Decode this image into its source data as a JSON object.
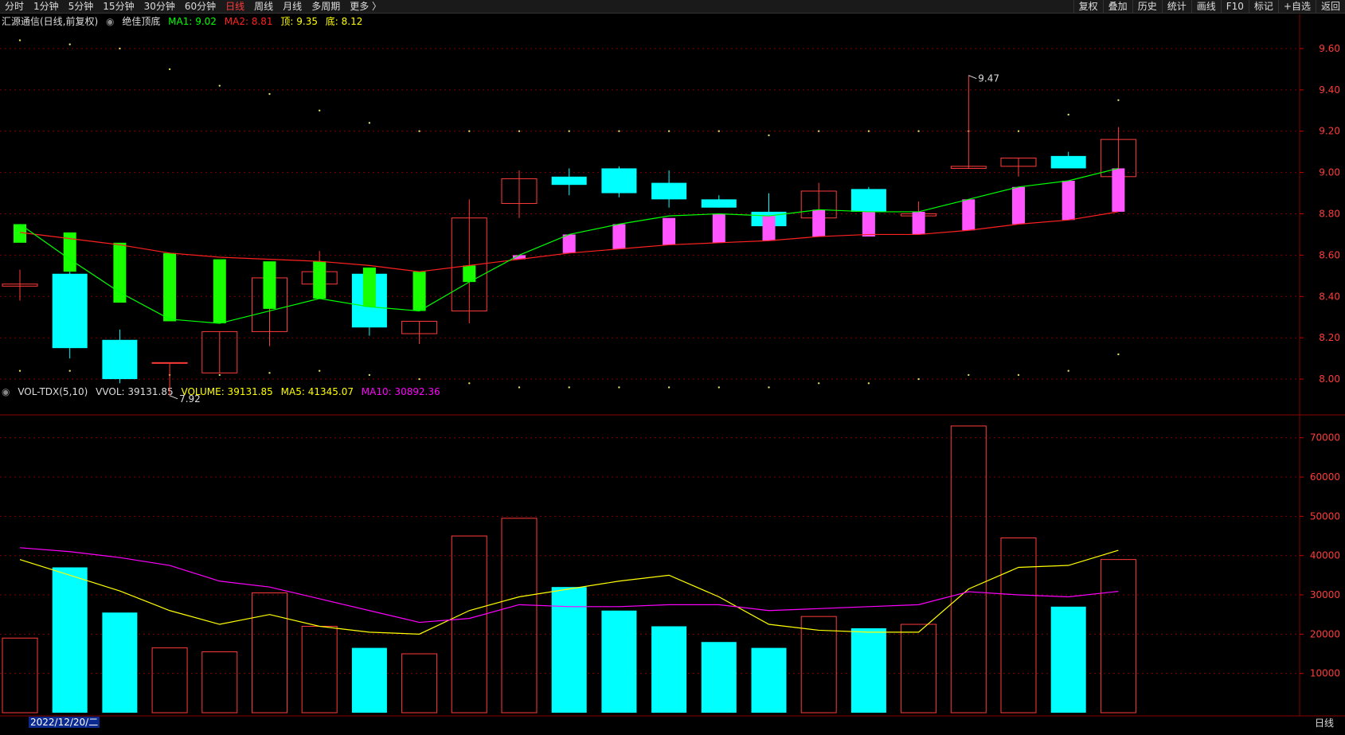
{
  "toolbar": {
    "left_tabs": [
      "分时",
      "1分钟",
      "5分钟",
      "15分钟",
      "30分钟",
      "60分钟",
      "日线",
      "周线",
      "月线",
      "多周期",
      "更多 〉"
    ],
    "active_tab": "日线",
    "right_tabs": [
      "复权",
      "叠加",
      "历史",
      "统计",
      "画线",
      "F10",
      "标记",
      "+自选",
      "返回"
    ]
  },
  "main_legend": {
    "title": "汇源通信(日线,前复权)",
    "indicator": "绝佳顶底",
    "ma1": "MA1: 9.02",
    "ma2": "MA2: 8.81",
    "top": "顶: 9.35",
    "bottom": "底: 8.12"
  },
  "vol_legend": {
    "name": "VOL-TDX(5,10)",
    "vvol": "VVOL: 39131.85",
    "volume": "VOLUME: 39131.85",
    "ma5": "MA5: 41345.07",
    "ma10": "MA10: 30892.36"
  },
  "colors": {
    "up": "#ff3b3b",
    "down_fill": "#00ffff",
    "indicator_green": "#18ff00",
    "indicator_pink": "#ff55ff",
    "ma1": "#00ff00",
    "ma2": "#ff2020",
    "vol_ma5": "#ffff00",
    "vol_ma10": "#ff00ff",
    "grid": "#7a0000"
  },
  "annotations": {
    "high": "9.47",
    "low": "7.92"
  },
  "status": {
    "date": "2022/12/20/二",
    "period_button": "日线"
  },
  "chart_data": [
    {
      "type": "candlestick",
      "title": "汇源通信(日线,前复权)",
      "ylim": [
        7.85,
        9.7
      ],
      "y_ticks": [
        "9.60",
        "9.40",
        "9.20",
        "9.00",
        "8.80",
        "8.60",
        "8.40",
        "8.20",
        "8.00"
      ],
      "candles": [
        {
          "o": 8.45,
          "h": 8.53,
          "l": 8.38,
          "c": 8.46,
          "up": true
        },
        {
          "o": 8.51,
          "h": 8.52,
          "l": 8.1,
          "c": 8.15,
          "up": false
        },
        {
          "o": 8.19,
          "h": 8.24,
          "l": 7.98,
          "c": 8.0,
          "up": false
        },
        {
          "o": 8.08,
          "h": 8.08,
          "l": 7.92,
          "c": 8.08,
          "up": true
        },
        {
          "o": 8.03,
          "h": 8.23,
          "l": 8.03,
          "c": 8.23,
          "up": true
        },
        {
          "o": 8.23,
          "h": 8.49,
          "l": 8.16,
          "c": 8.49,
          "up": true
        },
        {
          "o": 8.46,
          "h": 8.62,
          "l": 8.46,
          "c": 8.52,
          "up": true
        },
        {
          "o": 8.51,
          "h": 8.51,
          "l": 8.21,
          "c": 8.25,
          "up": false
        },
        {
          "o": 8.22,
          "h": 8.28,
          "l": 8.17,
          "c": 8.28,
          "up": true
        },
        {
          "o": 8.33,
          "h": 8.87,
          "l": 8.27,
          "c": 8.78,
          "up": true
        },
        {
          "o": 8.85,
          "h": 9.01,
          "l": 8.78,
          "c": 8.97,
          "up": true
        },
        {
          "o": 8.98,
          "h": 9.02,
          "l": 8.89,
          "c": 8.94,
          "up": false
        },
        {
          "o": 9.02,
          "h": 9.03,
          "l": 8.88,
          "c": 8.9,
          "up": false
        },
        {
          "o": 8.95,
          "h": 9.01,
          "l": 8.83,
          "c": 8.87,
          "up": false
        },
        {
          "o": 8.87,
          "h": 8.89,
          "l": 8.83,
          "c": 8.83,
          "up": false
        },
        {
          "o": 8.81,
          "h": 8.9,
          "l": 8.74,
          "c": 8.74,
          "up": false
        },
        {
          "o": 8.78,
          "h": 8.95,
          "l": 8.78,
          "c": 8.91,
          "up": true
        },
        {
          "o": 8.92,
          "h": 8.93,
          "l": 8.8,
          "c": 8.81,
          "up": false
        },
        {
          "o": 8.79,
          "h": 8.86,
          "l": 8.79,
          "c": 8.8,
          "up": true
        },
        {
          "o": 9.02,
          "h": 9.47,
          "l": 9.02,
          "c": 9.03,
          "up": true
        },
        {
          "o": 9.03,
          "h": 9.07,
          "l": 8.98,
          "c": 9.07,
          "up": true
        },
        {
          "o": 9.08,
          "h": 9.1,
          "l": 9.02,
          "c": 9.02,
          "up": false
        },
        {
          "o": 8.98,
          "h": 9.22,
          "l": 8.98,
          "c": 9.16,
          "up": true
        }
      ],
      "indicator_bars": [
        {
          "y1": 8.75,
          "y2": 8.66,
          "c": "green"
        },
        {
          "y1": 8.71,
          "y2": 8.52,
          "c": "green"
        },
        {
          "y1": 8.66,
          "y2": 8.37,
          "c": "green"
        },
        {
          "y1": 8.61,
          "y2": 8.28,
          "c": "green"
        },
        {
          "y1": 8.58,
          "y2": 8.27,
          "c": "green"
        },
        {
          "y1": 8.57,
          "y2": 8.34,
          "c": "green"
        },
        {
          "y1": 8.57,
          "y2": 8.39,
          "c": "green"
        },
        {
          "y1": 8.54,
          "y2": 8.35,
          "c": "green"
        },
        {
          "y1": 8.52,
          "y2": 8.33,
          "c": "green"
        },
        {
          "y1": 8.55,
          "y2": 8.47,
          "c": "green"
        },
        {
          "y1": 8.6,
          "y2": 8.58,
          "c": "pink"
        },
        {
          "y1": 8.7,
          "y2": 8.61,
          "c": "pink"
        },
        {
          "y1": 8.75,
          "y2": 8.63,
          "c": "pink"
        },
        {
          "y1": 8.78,
          "y2": 8.65,
          "c": "pink"
        },
        {
          "y1": 8.8,
          "y2": 8.66,
          "c": "pink"
        },
        {
          "y1": 8.79,
          "y2": 8.67,
          "c": "pink"
        },
        {
          "y1": 8.82,
          "y2": 8.69,
          "c": "pink"
        },
        {
          "y1": 8.81,
          "y2": 8.69,
          "c": "pink"
        },
        {
          "y1": 8.81,
          "y2": 8.7,
          "c": "pink"
        },
        {
          "y1": 8.87,
          "y2": 8.72,
          "c": "pink"
        },
        {
          "y1": 8.93,
          "y2": 8.75,
          "c": "pink"
        },
        {
          "y1": 8.96,
          "y2": 8.77,
          "c": "pink"
        },
        {
          "y1": 9.02,
          "y2": 8.81,
          "c": "pink"
        }
      ],
      "ma1": [
        8.75,
        8.58,
        8.42,
        8.29,
        8.27,
        8.33,
        8.39,
        8.35,
        8.33,
        8.47,
        8.6,
        8.7,
        8.75,
        8.79,
        8.8,
        8.79,
        8.82,
        8.81,
        8.81,
        8.87,
        8.93,
        8.96,
        9.02
      ],
      "ma2": [
        8.71,
        8.68,
        8.65,
        8.61,
        8.59,
        8.58,
        8.57,
        8.55,
        8.52,
        8.55,
        8.58,
        8.61,
        8.63,
        8.65,
        8.66,
        8.67,
        8.69,
        8.7,
        8.7,
        8.72,
        8.75,
        8.77,
        8.81
      ],
      "dots_top": [
        9.64,
        9.62,
        9.6,
        9.5,
        9.42,
        9.38,
        9.3,
        9.24,
        9.2,
        9.2,
        9.2,
        9.2,
        9.2,
        9.2,
        9.2,
        9.18,
        9.2,
        9.2,
        9.2,
        9.2,
        9.2,
        9.28,
        9.35
      ],
      "dots_bottom": [
        8.04,
        8.04,
        8.02,
        8.02,
        8.02,
        8.03,
        8.04,
        8.02,
        8.0,
        7.98,
        7.96,
        7.96,
        7.96,
        7.96,
        7.96,
        7.96,
        7.98,
        7.98,
        8.0,
        8.02,
        8.02,
        8.04,
        8.12
      ]
    },
    {
      "type": "bar",
      "title": "VOL-TDX(5,10)",
      "ylim": [
        0,
        74000
      ],
      "y_ticks": [
        "70000",
        "60000",
        "50000",
        "40000",
        "30000",
        "20000",
        "10000"
      ],
      "series": [
        {
          "name": "VOLUME",
          "values": [
            19000,
            37000,
            25500,
            16500,
            15500,
            30500,
            22000,
            16500,
            15000,
            45000,
            49500,
            32000,
            26000,
            22000,
            18000,
            16500,
            24500,
            21500,
            22500,
            73000,
            44500,
            27000,
            39000
          ],
          "up": [
            true,
            false,
            false,
            true,
            true,
            true,
            true,
            false,
            true,
            true,
            true,
            false,
            false,
            false,
            false,
            false,
            true,
            false,
            true,
            true,
            true,
            false,
            true
          ]
        },
        {
          "name": "MA5",
          "values": [
            39000,
            35000,
            31000,
            26000,
            22500,
            25000,
            22000,
            20500,
            20000,
            26000,
            29500,
            31500,
            33500,
            35000,
            29500,
            22500,
            21000,
            20500,
            20500,
            31500,
            37000,
            37500,
            41345
          ]
        },
        {
          "name": "MA10",
          "values": [
            42000,
            41000,
            39500,
            37500,
            33500,
            32000,
            29000,
            26000,
            23000,
            24000,
            27500,
            27000,
            27000,
            27500,
            27500,
            26000,
            26500,
            27000,
            27500,
            30800,
            30000,
            29500,
            30892
          ]
        }
      ]
    }
  ]
}
